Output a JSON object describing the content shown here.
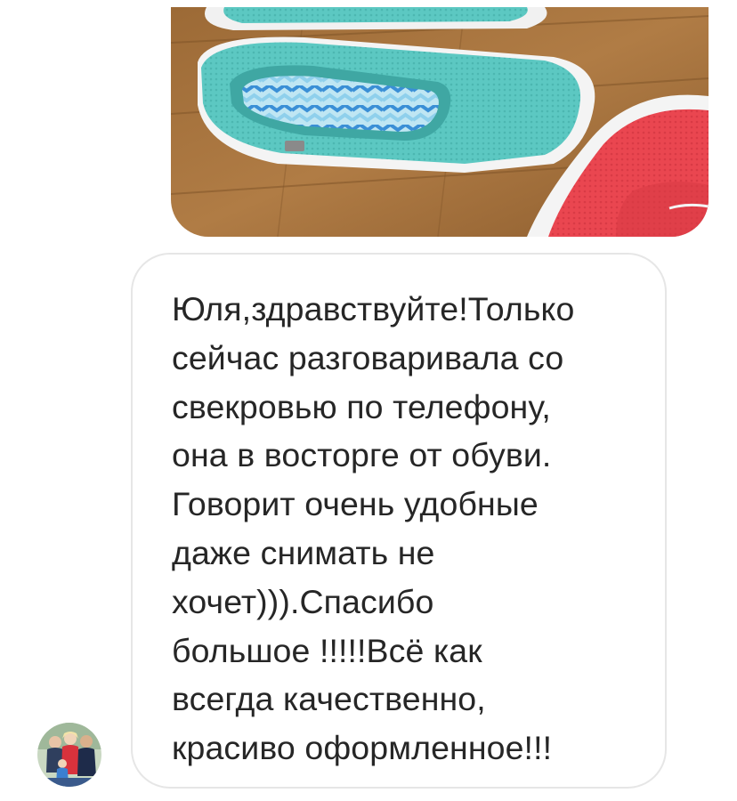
{
  "conversation": {
    "photo": {
      "icon": "shoe-photo",
      "colors": {
        "floor": "#a9763f",
        "shoe_turquoise": "#5ec9c4",
        "shoe_red": "#e8454e",
        "sole": "#f4f4f4"
      }
    },
    "message": {
      "lines": [
        "Юля,здравствуйте!Только",
        "сейчас разговаривала со",
        "свекровью по телефону,",
        "она в восторге от обуви.",
        "Говорит очень удобные",
        "даже снимать не",
        "хочет))).Спасибо",
        "большое !!!!!Всё как",
        "всегда качественно,",
        "красиво оформленное!!!"
      ]
    },
    "sender": {
      "avatar_icon": "family-photo"
    }
  }
}
